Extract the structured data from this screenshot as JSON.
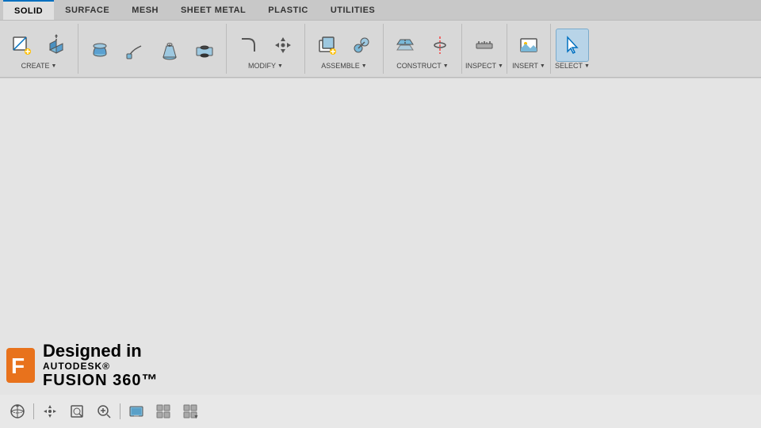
{
  "app": {
    "name": "Autodesk Fusion 360"
  },
  "tabs": [
    {
      "id": "solid",
      "label": "SOLID",
      "active": true
    },
    {
      "id": "surface",
      "label": "SURFACE",
      "active": false
    },
    {
      "id": "mesh",
      "label": "MESH",
      "active": false
    },
    {
      "id": "sheet-metal",
      "label": "SHEET METAL",
      "active": false
    },
    {
      "id": "plastic",
      "label": "PLASTIC",
      "active": false
    },
    {
      "id": "utilities",
      "label": "UTILITIES",
      "active": false
    }
  ],
  "toolbar_groups": [
    {
      "id": "create",
      "label": "CREATE",
      "has_dropdown": true
    },
    {
      "id": "modify",
      "label": "MODIFY",
      "has_dropdown": true
    },
    {
      "id": "assemble",
      "label": "ASSEMBLE",
      "has_dropdown": true
    },
    {
      "id": "construct",
      "label": "CONSTRUCT",
      "has_dropdown": true
    },
    {
      "id": "inspect",
      "label": "INSPECT",
      "has_dropdown": true
    },
    {
      "id": "insert",
      "label": "INSERT",
      "has_dropdown": true
    },
    {
      "id": "select",
      "label": "SELECT",
      "has_dropdown": true
    }
  ],
  "branding": {
    "designed_in": "Designed in",
    "autodesk": "AUTODESK®",
    "fusion": "FUSION 360™"
  },
  "bottom_tools": [
    "move",
    "pan",
    "zoom-fit",
    "zoom",
    "display",
    "grid",
    "grid-settings"
  ]
}
